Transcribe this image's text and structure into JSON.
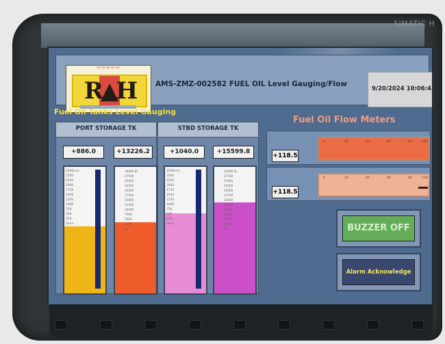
{
  "hardware": {
    "brand": "SIMATIC H"
  },
  "header": {
    "title": "AMS-ZMZ-002582 FUEL OIL Level Gauging/Flow",
    "datetime": "9/20/2024 10:06:4...",
    "logo_letters": "R▲H"
  },
  "tanks_section": {
    "title": "Fuel Oil Tanks Level Gauging",
    "tanks": [
      {
        "name": "PORT STORAGE TK",
        "level_value": "+886.0",
        "volume_value": "+13226.2",
        "level_fill_fraction": 0.53,
        "volume_fill_fraction": 0.56,
        "level_color": "#efb416",
        "volume_color": "#ed5c2a"
      },
      {
        "name": "STBD STORAGE TK",
        "level_value": "+1040.0",
        "volume_value": "+15599.8",
        "level_fill_fraction": 0.63,
        "volume_fill_fraction": 0.72,
        "level_color": "#e78bd6",
        "volume_color": "#cb4fc8"
      }
    ],
    "scales": {
      "level": [
        "2500mm",
        "2500",
        "2250",
        "2000",
        "1750",
        "1500",
        "1250",
        "1000",
        "750",
        "500",
        "250",
        "0mm"
      ],
      "volume": [
        "30000.0L",
        "27500",
        "25000",
        "22500",
        "20000",
        "17500",
        "15000",
        "12500",
        "10000",
        "7500",
        "5000",
        "2500",
        "0L"
      ]
    }
  },
  "flow_section": {
    "title": "Fuel Oil Flow Meters",
    "meters": [
      {
        "label": "",
        "value": "+118.5",
        "fill_color": "#ea6b44",
        "scale": [
          "0",
          "20",
          "40",
          "60",
          "80",
          "100"
        ]
      },
      {
        "label": "",
        "value": "+118.5",
        "fill_color": "#efb297",
        "scale": [
          "0",
          "20",
          "40",
          "60",
          "80",
          "100"
        ]
      }
    ]
  },
  "buttons": {
    "buzzer_off": "BUZZER OFF",
    "alarm_acknowledge": "Alarm Acknowledge"
  },
  "colors": {
    "screen_background": "#4f6b8f",
    "buzzer_green": "#64ad58",
    "alarm_navy": "#3a486f",
    "title_yellow": "#f4de38"
  }
}
